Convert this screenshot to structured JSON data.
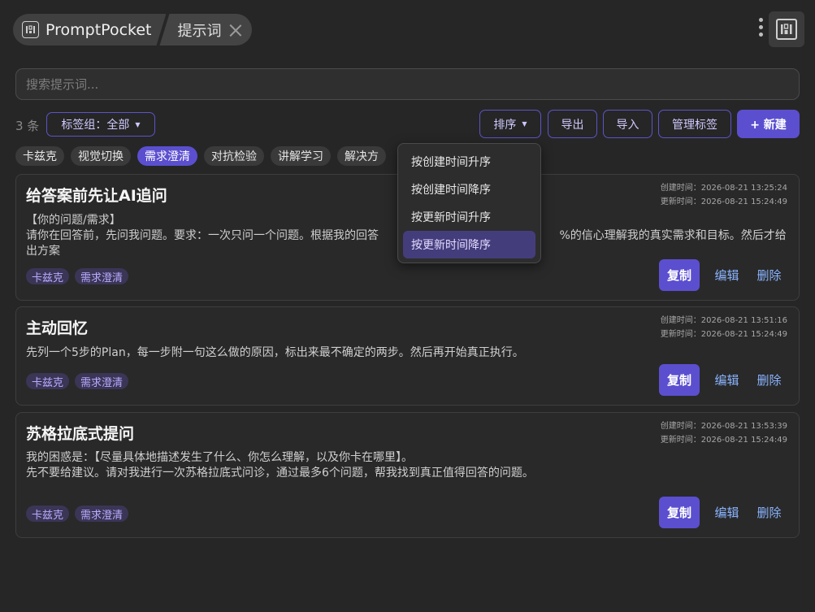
{
  "header": {
    "app_title": "PromptPocket",
    "tab_label": "提示词"
  },
  "search": {
    "placeholder": "搜索提示词..."
  },
  "toolbar": {
    "count": "3 条",
    "tag_group_label": "标签组：全部",
    "sort_label": "排序",
    "export_label": "导出",
    "import_label": "导入",
    "manage_tags_label": "管理标签",
    "new_label": "+ 新建"
  },
  "tag_filters": [
    "卡兹克",
    "视觉切换",
    "需求澄清",
    "对抗检验",
    "讲解学习",
    "解决方"
  ],
  "active_tag": "需求澄清",
  "sort_menu": {
    "items": [
      "按创建时间升序",
      "按创建时间降序",
      "按更新时间升序",
      "按更新时间降序"
    ],
    "selected_index": 3
  },
  "prompts": [
    {
      "title": "给答案前先让AI追问",
      "created": "创建时间：2026-08-21 13:25:24",
      "updated": "更新时间：2026-08-21 15:24:49",
      "body": "【你的问题/需求】\n请你在回答前，先问我问题。要求：一次只问一个问题。根据我的回答                                                  %的信心理解我的真实需求和目标。然后才给出方案",
      "tags": [
        "卡兹克",
        "需求澄清"
      ]
    },
    {
      "title": "主动回忆",
      "created": "创建时间：2026-08-21 13:51:16",
      "updated": "更新时间：2026-08-21 15:24:49",
      "body": "先列一个5步的Plan，每一步附一句这么做的原因，标出来最不确定的两步。然后再开始真正执行。",
      "tags": [
        "卡兹克",
        "需求澄清"
      ]
    },
    {
      "title": "苏格拉底式提问",
      "created": "创建时间：2026-08-21 13:53:39",
      "updated": "更新时间：2026-08-21 15:24:49",
      "body": "我的困惑是：【尽量具体地描述发生了什么、你怎么理解，以及你卡在哪里】。\n先不要给建议。请对我进行一次苏格拉底式问诊，通过最多6个问题，帮我找到真正值得回答的问题。",
      "tags": [
        "卡兹克",
        "需求澄清"
      ]
    }
  ],
  "card_actions": {
    "copy": "复制",
    "edit": "编辑",
    "delete": "删除"
  },
  "colors": {
    "accent": "#5b4fcf",
    "link": "#8ab4ff",
    "background": "#262626"
  },
  "icons": {
    "app_logo": "binary-icon",
    "menu": "kebab-menu-icon",
    "tab_close": "close-icon"
  }
}
